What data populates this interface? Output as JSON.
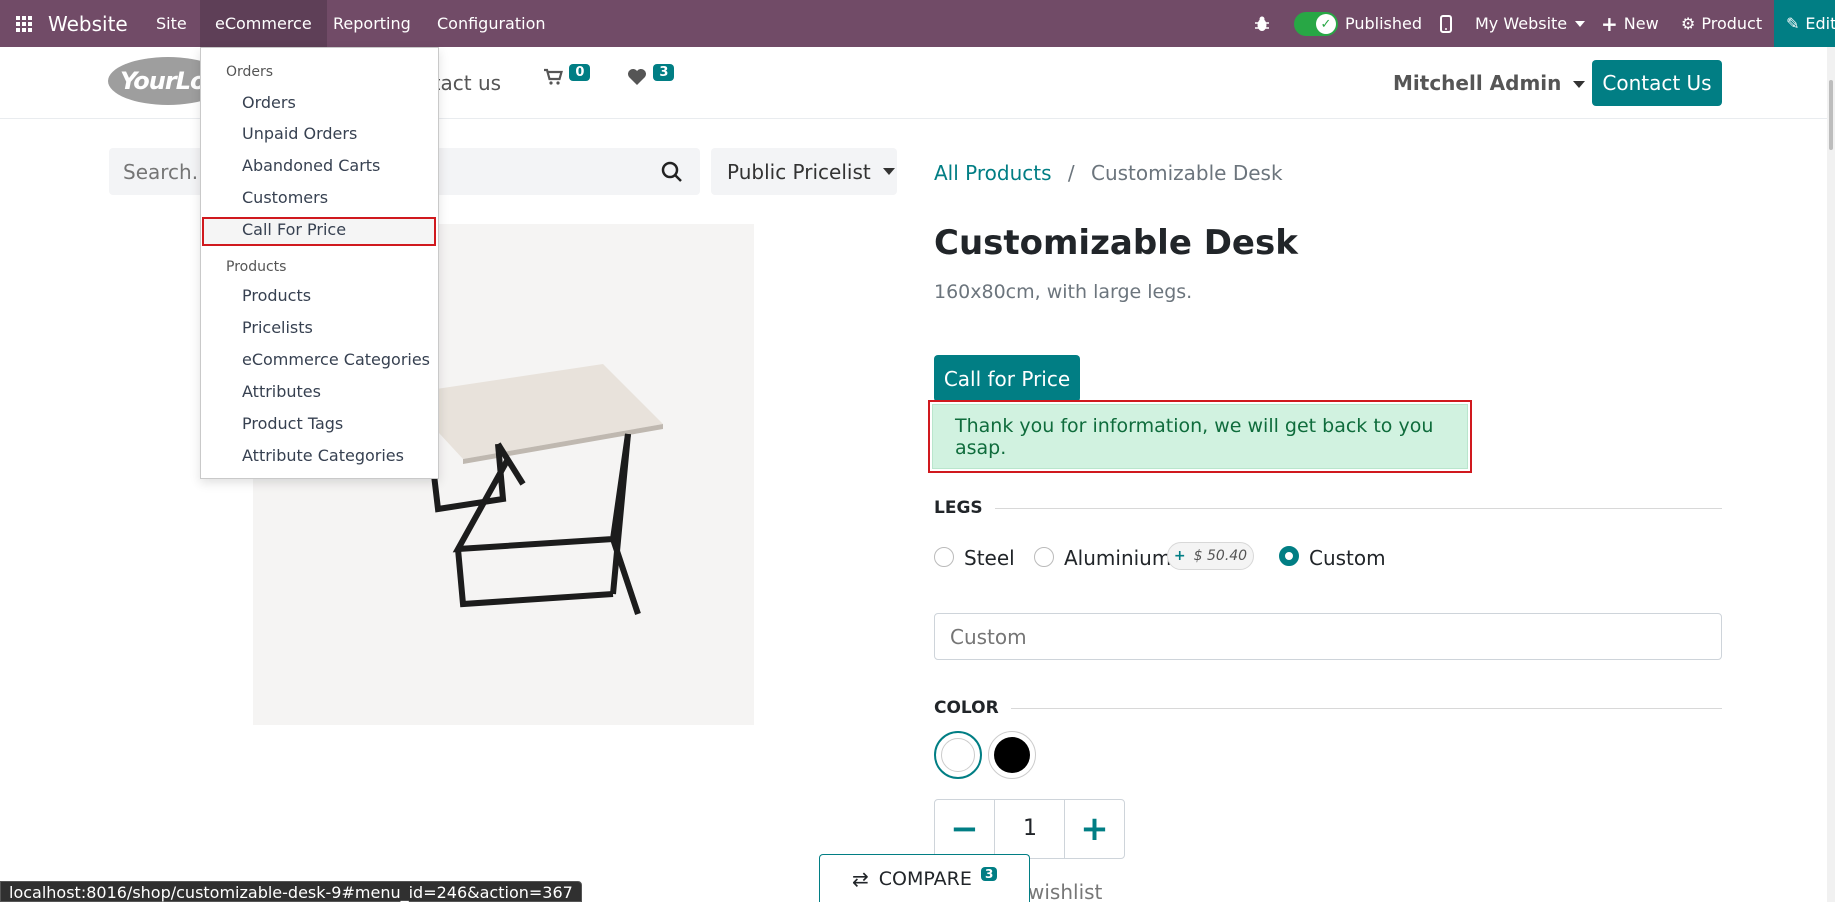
{
  "topbar": {
    "app_name": "Website",
    "menus": [
      "Site",
      "eCommerce",
      "Reporting",
      "Configuration"
    ],
    "published_label": "Published",
    "website_label": "My Website",
    "new_label": "New",
    "product_label": "Product",
    "edit_label": "Edit",
    "colors": {
      "bar": "#714B67",
      "active": "#5E3F57",
      "edit": "#017e84"
    }
  },
  "dropdown": {
    "orders_header": "Orders",
    "orders_items": [
      "Orders",
      "Unpaid Orders",
      "Abandoned Carts",
      "Customers",
      "Call For Price"
    ],
    "products_header": "Products",
    "products_items": [
      "Products",
      "Pricelists",
      "eCommerce Categories",
      "Attributes",
      "Product Tags",
      "Attribute Categories"
    ]
  },
  "header": {
    "logo_text": "YourLog",
    "nav_contact": "ntact us",
    "cart_count": "0",
    "wishlist_count": "3",
    "user_name": "Mitchell Admin",
    "contact_button": "Contact Us"
  },
  "search": {
    "placeholder": "Search...",
    "pricelist": "Public Pricelist"
  },
  "breadcrumb": {
    "parent": "All Products",
    "separator": "/",
    "current": "Customizable Desk"
  },
  "product": {
    "title": "Customizable Desk",
    "description": "160x80cm, with large legs.",
    "call_button": "Call for Price",
    "alert_message": "Thank you for information, we will get back to you asap.",
    "legs_title": "LEGS",
    "legs_options": [
      "Steel",
      "Aluminium",
      "Custom"
    ],
    "legs_selected": "Custom",
    "aluminium_price_sign": "+",
    "aluminium_price": "$ 50.40",
    "custom_placeholder": "Custom",
    "color_title": "COLOR",
    "colors": [
      "#ffffff",
      "#000000"
    ],
    "quantity": "1",
    "wishlist_text": "wishlist",
    "accent": "#017e84"
  },
  "compare": {
    "label": "COMPARE",
    "count": "3"
  },
  "status_url": "localhost:8016/shop/customizable-desk-9#menu_id=246&action=367"
}
